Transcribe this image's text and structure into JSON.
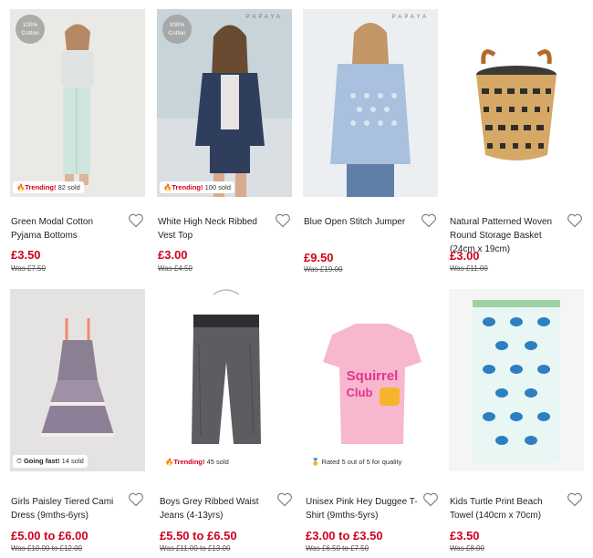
{
  "products": [
    {
      "name": "Green Modal Cotton Pyjama Bottoms",
      "price": "£3.50",
      "was": "Was £7.50",
      "badge_prefix": "🔥",
      "badge_bold": "Trending!",
      "badge_rest": " 82 sold",
      "tag": "100% Cotton",
      "brand": ""
    },
    {
      "name": "White High Neck Ribbed Vest Top",
      "price": "£3.00",
      "was": "Was £4.50",
      "badge_prefix": "🔥",
      "badge_bold": "Trending!",
      "badge_rest": " 100 sold",
      "tag": "100% Cotton",
      "brand": "PAPAYA"
    },
    {
      "name": "Blue Open Stitch Jumper",
      "price": "£9.50",
      "was": "Was £19.00",
      "badge_prefix": "",
      "badge_bold": "",
      "badge_rest": "",
      "tag": "",
      "brand": "PAPAYA"
    },
    {
      "name": "Natural Patterned Woven Round Storage Basket (24cm x 19cm)",
      "price": "£3.00",
      "was": "Was £11.00",
      "badge_prefix": "",
      "badge_bold": "",
      "badge_rest": "",
      "tag": "",
      "brand": ""
    },
    {
      "name": "Girls Paisley Tiered Cami Dress (9mths-6yrs)",
      "price": "£5.00 to £6.00",
      "was": "Was £10.00 to £12.00",
      "badge_prefix": "⏱",
      "badge_bold": "Going fast!",
      "badge_rest": " 14 sold",
      "tag": "",
      "brand": ""
    },
    {
      "name": "Boys Grey Ribbed Waist Jeans (4-13yrs)",
      "price": "£5.50 to £6.50",
      "was": "Was £11.00 to £13.00",
      "badge_prefix": "🔥",
      "badge_bold": "Trending!",
      "badge_rest": " 45 sold",
      "tag": "",
      "brand": ""
    },
    {
      "name": "Unisex Pink Hey Duggee T-Shirt (9mths-5yrs)",
      "price": "£3.00 to £3.50",
      "was": "Was £6.50 to £7.50",
      "badge_prefix": "🏅",
      "badge_bold": "",
      "badge_rest": "Rated 5 out of 5 for quality",
      "tag": "",
      "brand": ""
    },
    {
      "name": "Kids Turtle Print Beach Towel (140cm x 70cm)",
      "price": "£3.50",
      "was": "Was £8.00",
      "badge_prefix": "",
      "badge_bold": "",
      "badge_rest": "",
      "tag": "",
      "brand": ""
    }
  ],
  "tshirt_text": {
    "line1": "Squirrel",
    "line2": "Club"
  },
  "colors": {
    "price_red": "#d0021b",
    "trending_red": "#d0021b"
  }
}
